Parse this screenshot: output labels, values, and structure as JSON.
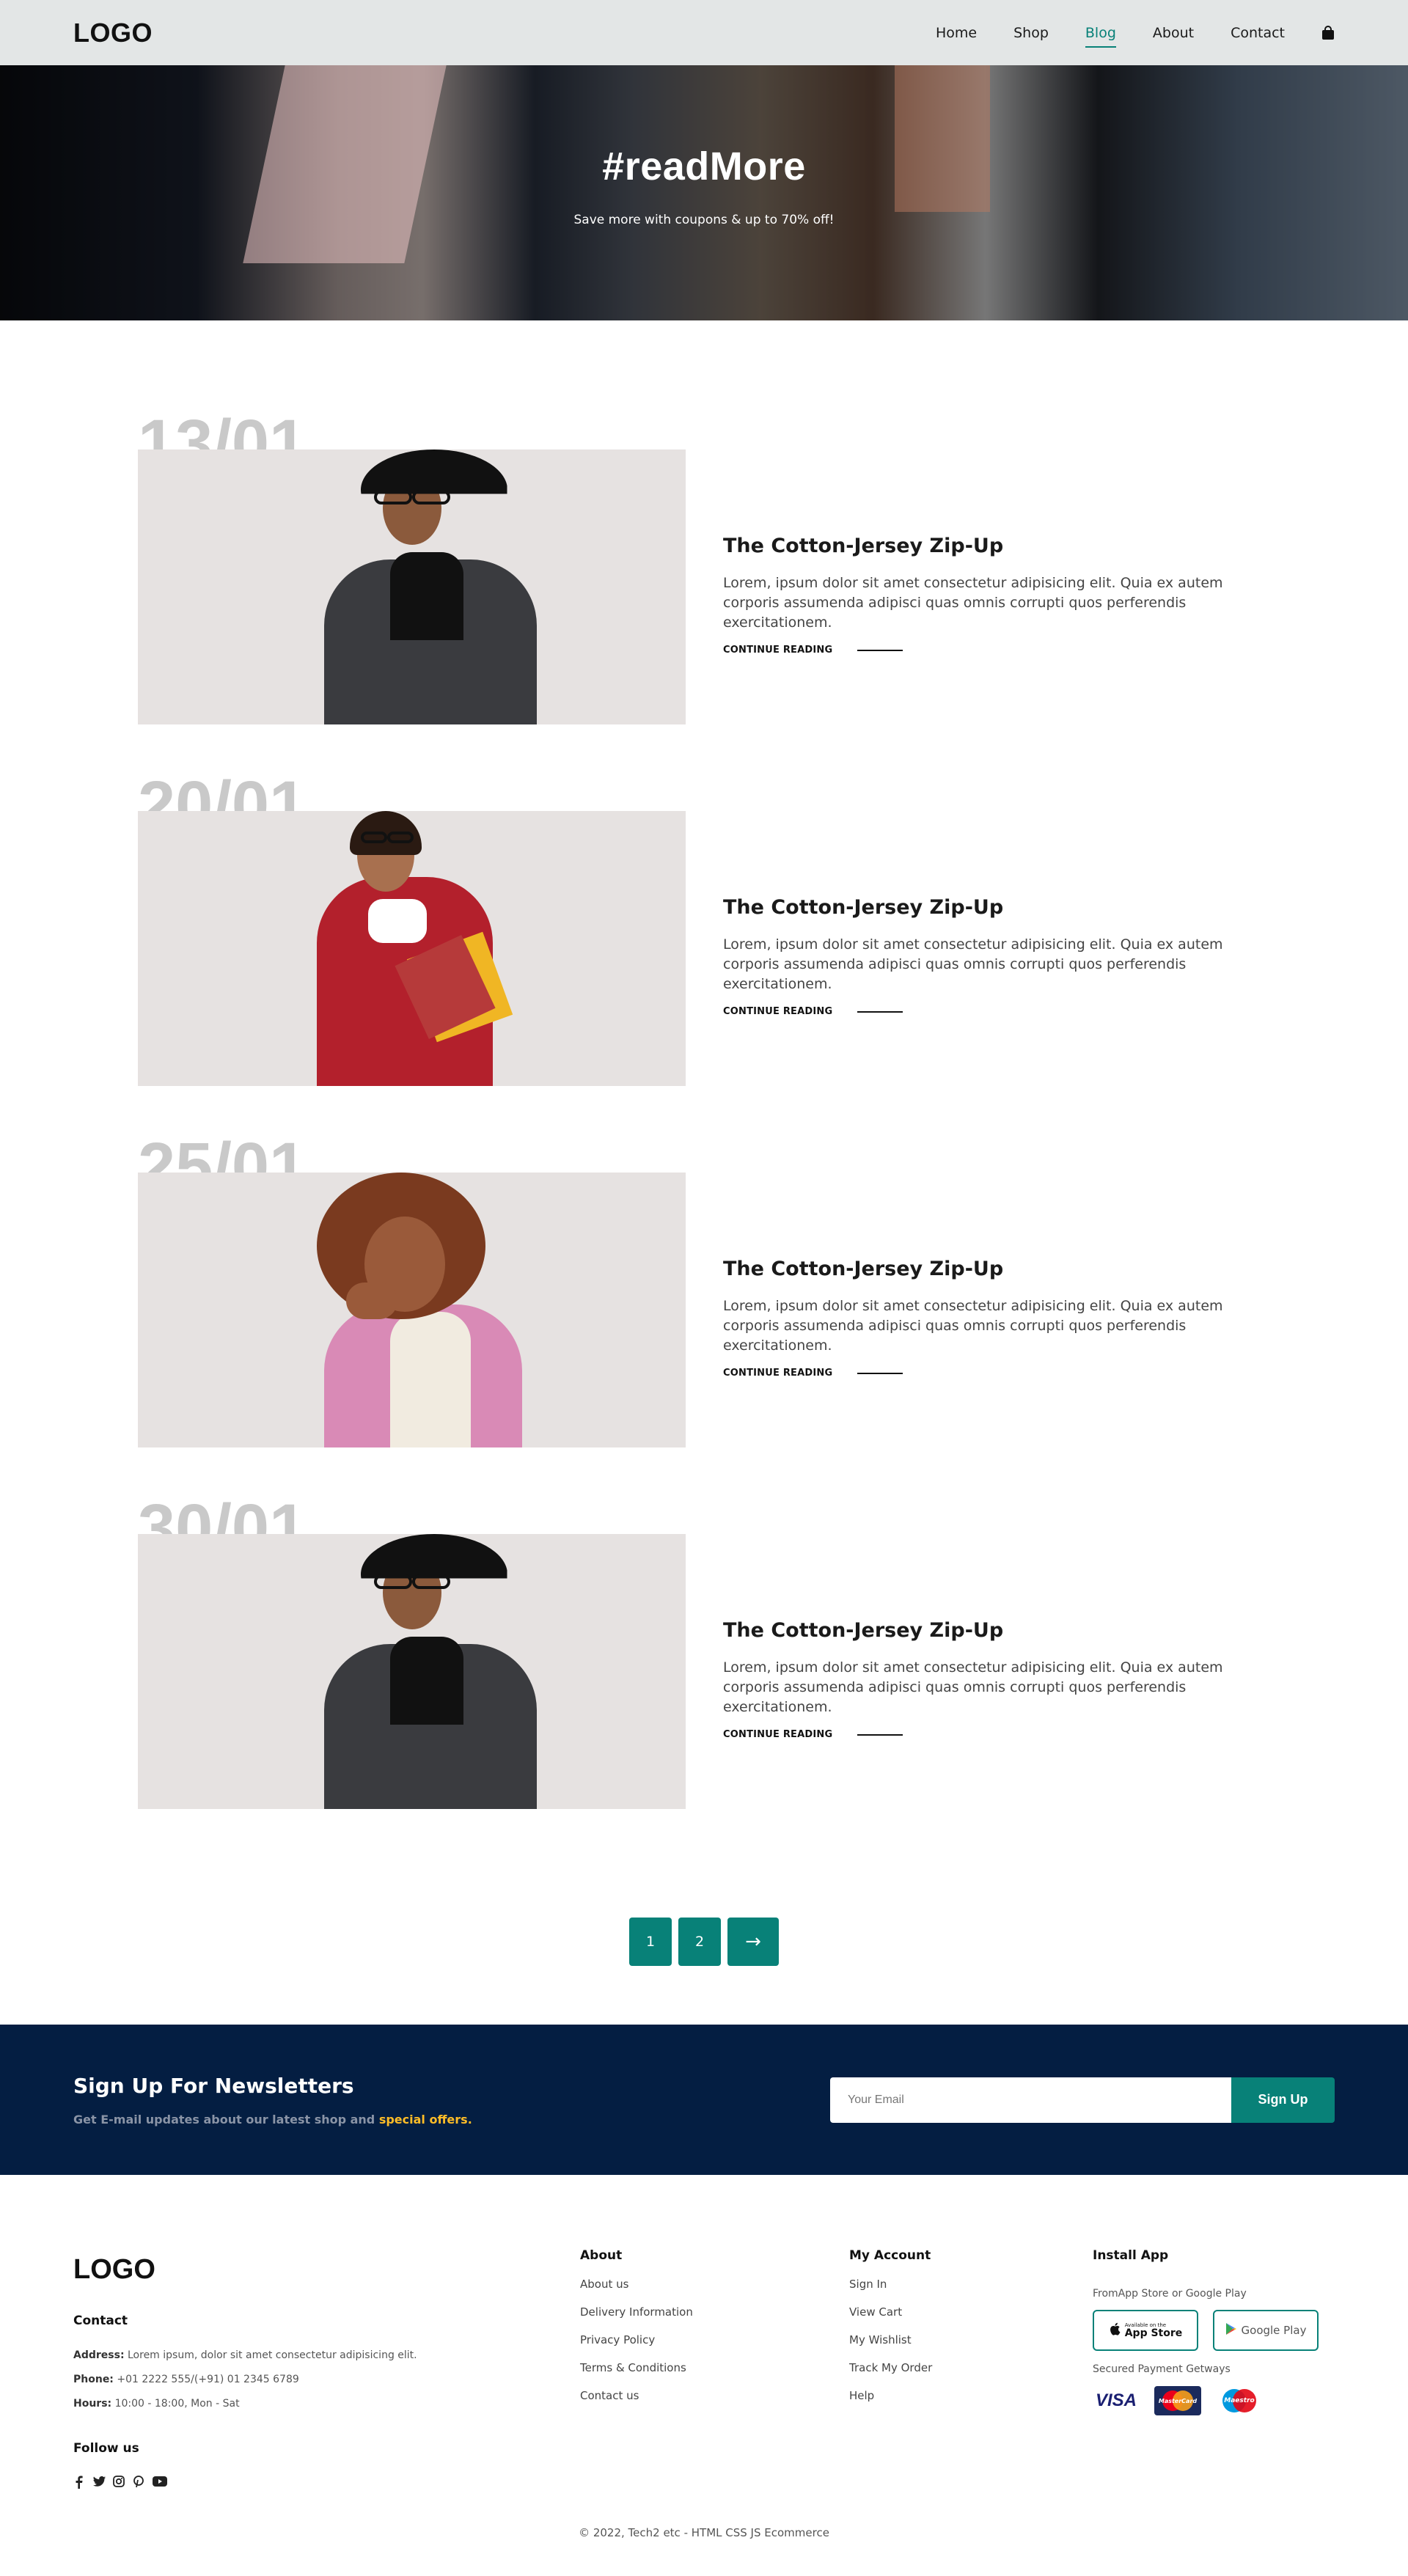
{
  "header": {
    "logo": "LOGO",
    "nav": [
      {
        "label": "Home"
      },
      {
        "label": "Shop"
      },
      {
        "label": "Blog"
      },
      {
        "label": "About"
      },
      {
        "label": "Contact"
      }
    ],
    "active_nav": "Blog",
    "cart_icon": "shopping-bag-icon"
  },
  "hero": {
    "title": "#readMore",
    "subtitle": "Save more with coupons & up to 70% off!"
  },
  "posts": [
    {
      "date": "13/01",
      "title": "The Cotton-Jersey Zip-Up",
      "text": "Lorem, ipsum dolor sit amet consectetur adipisicing elit. Quia ex autem corporis assumenda adipisci quas omnis corrupti quos perferendis exercitationem.",
      "link": "CONTINUE READING"
    },
    {
      "date": "20/01",
      "title": "The Cotton-Jersey Zip-Up",
      "text": "Lorem, ipsum dolor sit amet consectetur adipisicing elit. Quia ex autem corporis assumenda adipisci quas omnis corrupti quos perferendis exercitationem.",
      "link": "CONTINUE READING"
    },
    {
      "date": "25/01",
      "title": "The Cotton-Jersey Zip-Up",
      "text": "Lorem, ipsum dolor sit amet consectetur adipisicing elit. Quia ex autem corporis assumenda adipisci quas omnis corrupti quos perferendis exercitationem.",
      "link": "CONTINUE READING"
    },
    {
      "date": "30/01",
      "title": "The Cotton-Jersey Zip-Up",
      "text": "Lorem, ipsum dolor sit amet consectetur adipisicing elit. Quia ex autem corporis assumenda adipisci quas omnis corrupti quos perferendis exercitationem.",
      "link": "CONTINUE READING"
    }
  ],
  "pagination": {
    "pages": [
      "1",
      "2"
    ],
    "next": "→"
  },
  "newsletter": {
    "title": "Sign Up For Newsletters",
    "subtitle_prefix": "Get E-mail updates about our latest shop and ",
    "subtitle_highlight": "special offers.",
    "placeholder": "Your Email",
    "button": "Sign Up"
  },
  "footer": {
    "logo": "LOGO",
    "contact_heading": "Contact",
    "address_label": "Address:",
    "address": "Lorem ipsum, dolor sit amet consectetur adipisicing elit.",
    "phone_label": "Phone:",
    "phone": "+01 2222 555/(+91) 01 2345 6789",
    "hours_label": "Hours:",
    "hours": "10:00 - 18:00, Mon - Sat",
    "follow_heading": "Follow us",
    "social_icons": [
      "facebook-icon",
      "twitter-icon",
      "instagram-icon",
      "pinterest-icon",
      "youtube-icon"
    ],
    "about": {
      "heading": "About",
      "links": [
        "About us",
        "Delivery Information",
        "Privacy Policy",
        "Terms & Conditions",
        "Contact us"
      ]
    },
    "account": {
      "heading": "My Account",
      "links": [
        "Sign In",
        "View Cart",
        "My Wishlist",
        "Track My Order",
        "Help"
      ]
    },
    "install": {
      "heading": "Install App",
      "subtitle": "FromApp Store or Google Play",
      "app_store_small": "Available on the",
      "app_store": "App Store",
      "google_play": "Google Play",
      "payments_label": "Secured Payment Getways",
      "payments": [
        "VISA",
        "MasterCard",
        "Maestro"
      ]
    },
    "copyright": "© 2022, Tech2 etc - HTML CSS JS Ecommerce"
  },
  "colors": {
    "accent": "#088178",
    "navy": "#041e42",
    "highlight": "#ffbd27"
  }
}
